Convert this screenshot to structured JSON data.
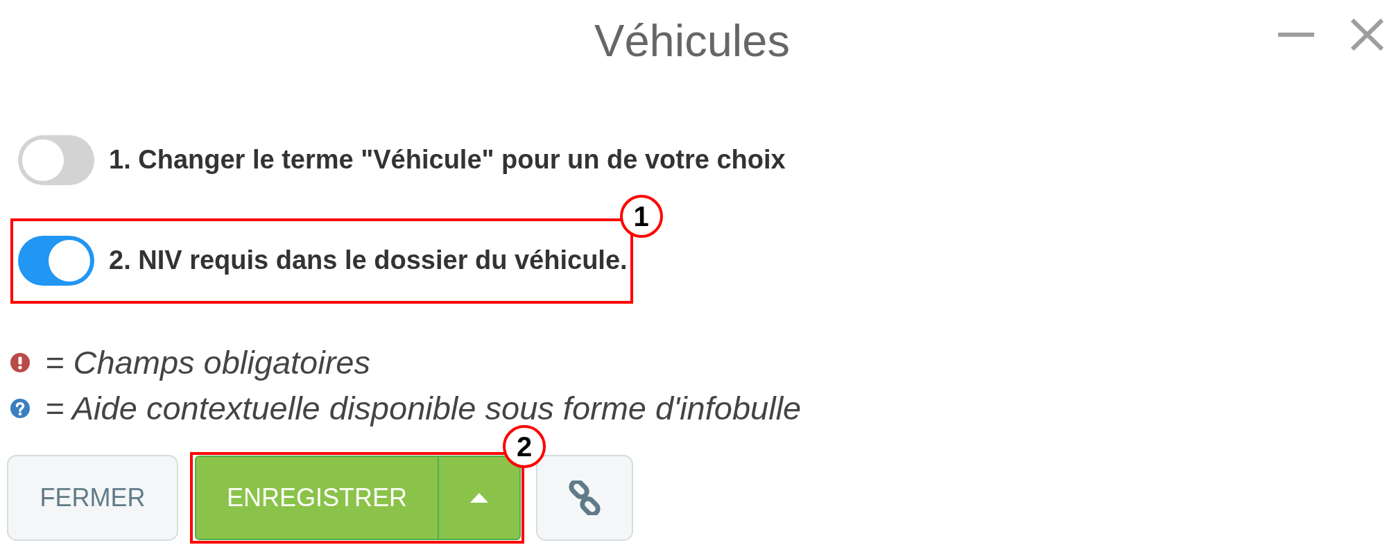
{
  "window": {
    "title": "Véhicules"
  },
  "options": [
    {
      "label": "1. Changer le terme \"Véhicule\" pour un de votre choix",
      "on": false
    },
    {
      "label": "2. NIV requis dans le dossier du véhicule.",
      "on": true,
      "callout": "1"
    }
  ],
  "legend": [
    {
      "kind": "required",
      "text": "= Champs obligatoires"
    },
    {
      "kind": "help",
      "text": "= Aide contextuelle disponible sous forme d'infobulle"
    }
  ],
  "buttons": [
    {
      "kind": "plain",
      "label": "FERMER"
    },
    {
      "kind": "split",
      "label": "ENREGISTRER",
      "callout": "2"
    },
    {
      "kind": "icon"
    }
  ]
}
